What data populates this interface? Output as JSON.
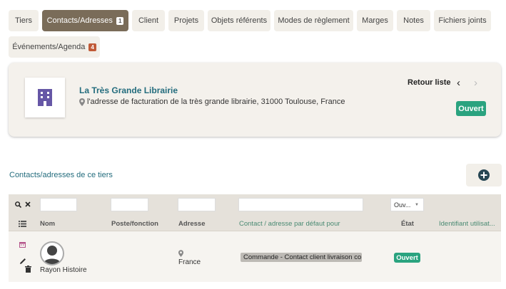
{
  "tabs": [
    {
      "label": "Tiers"
    },
    {
      "label": "Contacts/Adresses",
      "count": "1"
    },
    {
      "label": "Client"
    },
    {
      "label": "Projets"
    },
    {
      "label": "Objets référents"
    },
    {
      "label": "Modes de règlement"
    },
    {
      "label": "Marges"
    },
    {
      "label": "Notes"
    },
    {
      "label": "Fichiers joints"
    },
    {
      "label": "Événements/Agenda",
      "count": "4"
    }
  ],
  "header": {
    "company_name": "La Très Grande Librairie",
    "address": "l'adresse de facturation de la très grande librairie, 31000 Toulouse, France",
    "back_to_list": "Retour liste",
    "status": "Ouvert",
    "building_icon": "building-icon",
    "map_marker_icon": "map-marker-icon"
  },
  "section": {
    "title": "Contacts/adresses de ce tiers",
    "add_icon": "plus-circle-icon"
  },
  "table": {
    "filters": {
      "status_select": "Ouv..."
    },
    "columns": [
      "Nom",
      "Poste/fonction",
      "Adresse",
      "Contact / adresse par défaut pour",
      "État",
      "Identifiant utilisat..."
    ],
    "rows": [
      {
        "name": "Rayon Histoire",
        "position": "",
        "address": "France",
        "default_for": "Commande - Contact client livraison co",
        "status": "Ouvert"
      }
    ]
  },
  "colors": {
    "accent_teal": "#236c7d",
    "active_tab": "#7a6c59",
    "status_green": "#2aa37f",
    "badge_orange": "#c05a37",
    "building_purple": "#6657a6"
  }
}
